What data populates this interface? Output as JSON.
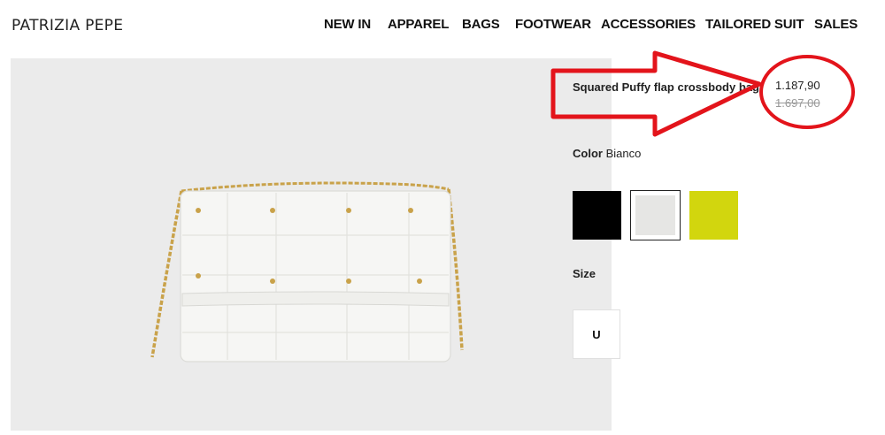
{
  "brand": {
    "logo_text": "PATRIZIA PEPE"
  },
  "nav": {
    "items": [
      {
        "label": "NEW IN"
      },
      {
        "label": "APPAREL"
      },
      {
        "label": "BAGS"
      },
      {
        "label": "FOOTWEAR"
      },
      {
        "label": "ACCESSORIES"
      },
      {
        "label": "TAILORED SUIT"
      },
      {
        "label": "SALES"
      }
    ]
  },
  "product": {
    "title": "Squared Puffy flap crossbody bag",
    "price": "1.187,90",
    "old_price": "1.697,00",
    "color_label": "Color",
    "color_value": "Bianco",
    "swatches": [
      {
        "name": "black",
        "color": "#000000",
        "selected": false
      },
      {
        "name": "white",
        "color": "#e6e6e4",
        "selected": true
      },
      {
        "name": "lime",
        "color": "#d2d60e",
        "selected": false
      }
    ],
    "size_label": "Size",
    "sizes": [
      {
        "label": "U"
      }
    ]
  },
  "colors": {
    "annotation_red": "#e3141b",
    "image_background": "#ebebeb"
  }
}
